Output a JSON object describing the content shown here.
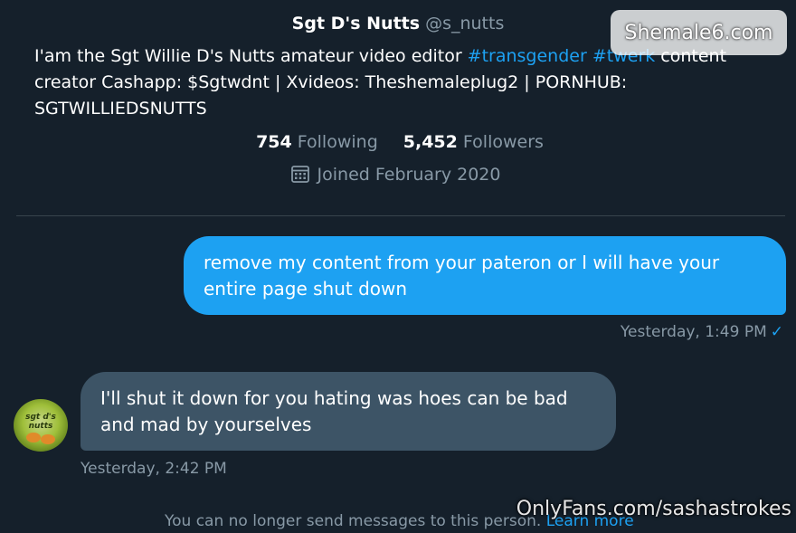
{
  "profile": {
    "name": "Sgt D's Nutts",
    "handle": "@s_nutts",
    "bio_line1": "I'am the Sgt Willie D's Nutts amateur video editor ",
    "hashtag1": "#transgender",
    "hashtag2": "#twerk",
    "bio_line1_tail": " content",
    "bio_line2": "creator Cashapp: $Sgtwdnt | Xvideos: Theshemaleplug2 | PORNHUB:",
    "bio_line3": "SGTWILLIEDSNUTTS",
    "following_count": "754",
    "following_label": "Following",
    "followers_count": "5,452",
    "followers_label": "Followers",
    "joined": "Joined February 2020",
    "calendar_icon": "calendar-icon"
  },
  "messages": [
    {
      "direction": "sent",
      "text_line1": "remove my content from your pateron or I will have your",
      "text_line2": "entire page shut down",
      "time": "Yesterday, 1:49 PM",
      "status_icon": "✓",
      "bubble_color": "#1da1f2"
    },
    {
      "direction": "received",
      "text_line1": "I'll shut it down for you hating was hoes can be bad",
      "text_line2": "and mad by yourselves",
      "time": "Yesterday, 2:42 PM",
      "avatar_text": "sgt d's nutts",
      "bubble_color": "#3d5466"
    }
  ],
  "footer": {
    "notice": "You can no longer send messages to this person. ",
    "learn_more": "Learn more"
  },
  "watermarks": {
    "top_right": "Shemale6.com",
    "bottom_right": "OnlyFans.com/sashastrokes"
  },
  "colors": {
    "background": "#15202b",
    "accent": "#1da1f2",
    "secondary_text": "#8899a6"
  }
}
